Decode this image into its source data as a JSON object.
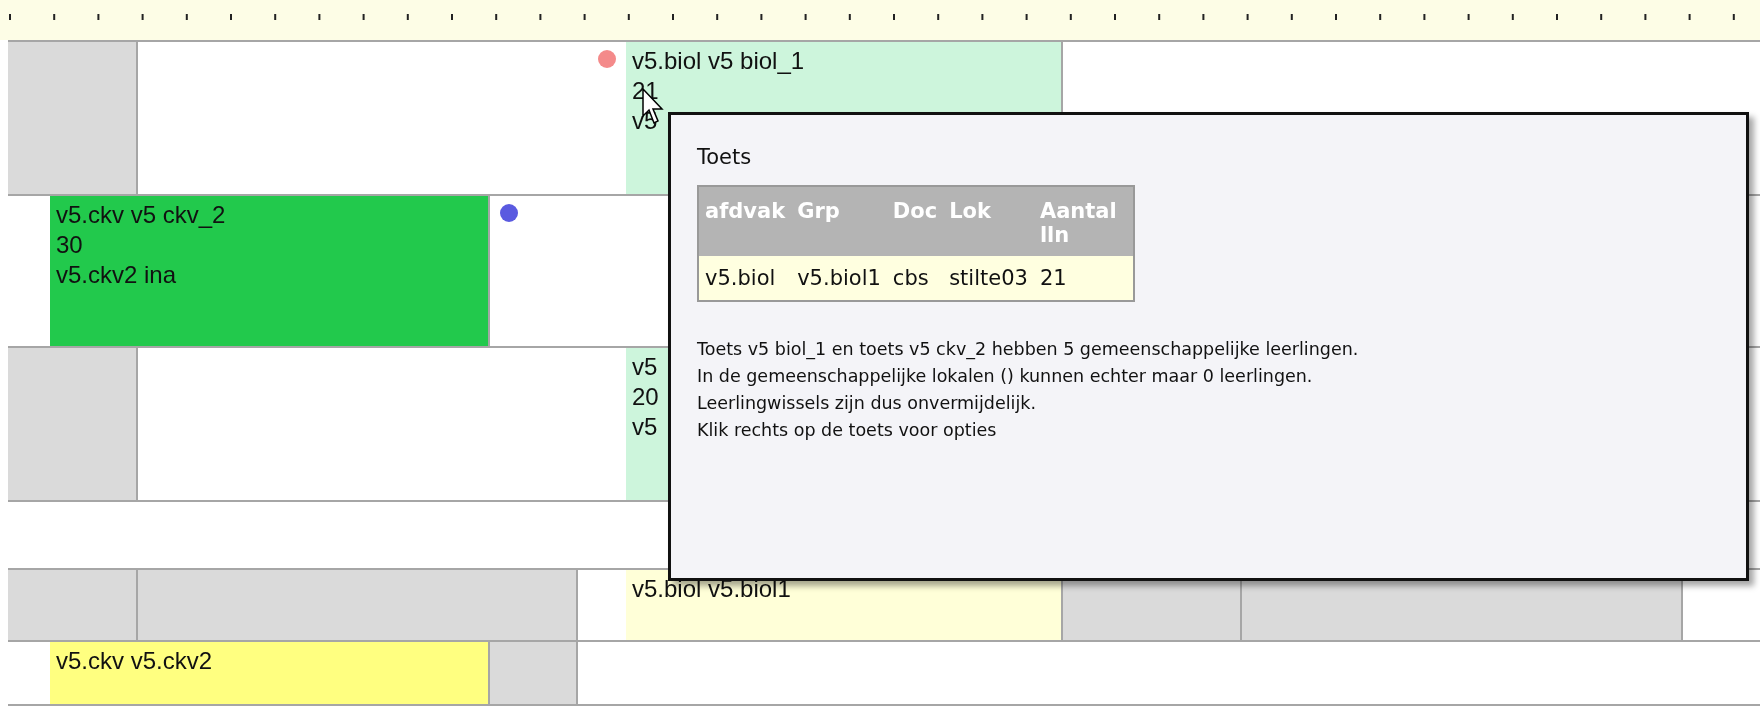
{
  "rows": [
    {
      "cells": [
        {
          "kind": "closed"
        },
        {
          "kind": "blank",
          "marker": {
            "color": "#f48a8a"
          }
        },
        {
          "kind": "test",
          "color": "#cdf5dc",
          "lines": [
            "v5.biol v5 biol_1",
            "21",
            "v5"
          ]
        },
        {
          "kind": "blank"
        }
      ]
    },
    {
      "cells": [
        {
          "kind": "blank"
        },
        {
          "kind": "test",
          "color": "#22c94c",
          "lines": [
            "v5.ckv v5 ckv_2",
            "30",
            "v5.ckv2 ina"
          ]
        },
        {
          "kind": "blank",
          "marker": {
            "color": "#5a5ae0"
          }
        }
      ]
    },
    {
      "cells": [
        {
          "kind": "closed"
        },
        {
          "kind": "blank"
        },
        {
          "kind": "test",
          "color": "#cdf5dc",
          "lines": [
            "v5",
            "20",
            "v5"
          ]
        },
        {
          "kind": "blank"
        }
      ]
    },
    {
      "cells": [
        {
          "kind": "blank"
        }
      ]
    },
    {
      "cells": [
        {
          "kind": "closed"
        },
        {
          "kind": "closed"
        },
        {
          "kind": "blank"
        },
        {
          "kind": "test",
          "color": "#ffffd8",
          "lines": [
            "v5.biol v5.biol1"
          ]
        },
        {
          "kind": "closed"
        },
        {
          "kind": "closed"
        },
        {
          "kind": "blank"
        }
      ]
    },
    {
      "cells": [
        {
          "kind": "blank"
        },
        {
          "kind": "test",
          "color": "#ffff80",
          "lines": [
            "v5.ckv v5.ckv2"
          ]
        },
        {
          "kind": "closed"
        },
        {
          "kind": "blank"
        }
      ]
    }
  ],
  "tooltip": {
    "title": "Toets",
    "table": {
      "columns": [
        "afdvak",
        "Grp",
        "Doc",
        "Lok",
        "Aantal lln"
      ],
      "rows": [
        [
          "v5.biol",
          "v5.biol1",
          "cbs",
          "stilte03",
          "21"
        ]
      ]
    },
    "message": [
      "Toets v5 biol_1 en toets v5 ckv_2 hebben 5 gemeenschappelijke leerlingen.",
      "In de gemeenschappelijke lokalen () kunnen echter maar 0 leerlingen.",
      "Leerlingwissels zijn dus onvermijdelijk.",
      "Klik rechts op de toets voor opties"
    ]
  }
}
